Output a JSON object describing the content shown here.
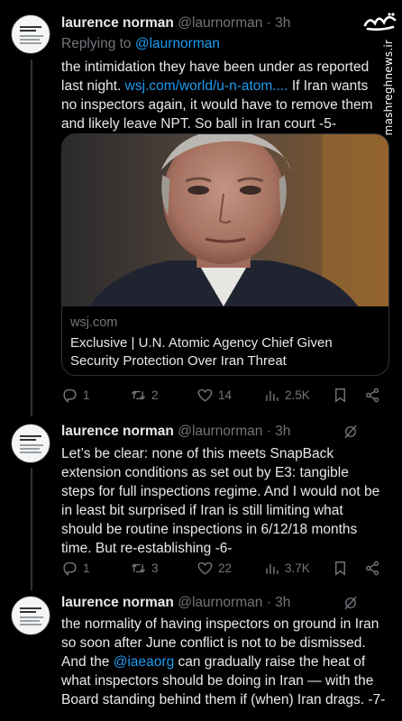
{
  "watermark": {
    "logo_text": "مشرق",
    "site": "mashreghnews.ir"
  },
  "tweets": [
    {
      "name": "laurence norman",
      "handle": "@laurnorman",
      "time": "· 3h",
      "reply_prefix": "Replying to ",
      "reply_handle": "@laurnorman",
      "text_before": "the intimidation they have been under as reported last night. ",
      "link": "wsj.com/world/u-n-atom....",
      "text_after": " If Iran wants no inspectors again, it would have to remove them and likely leave NPT. So ball in Iran court -5-",
      "card": {
        "domain": "wsj.com",
        "title": "Exclusive | U.N. Atomic Agency Chief Given Security Protection Over Iran Threat"
      },
      "actions": {
        "replies": "1",
        "reposts": "2",
        "likes": "14",
        "views": "2.5K"
      }
    },
    {
      "name": "laurence norman",
      "handle": "@laurnorman",
      "time": "· 3h",
      "text": "Let’s be clear: none of this meets SnapBack extension conditions as set out by E3: tangible steps for full inspections regime. And I would not be in least bit surprised if Iran is still limiting what should be routine inspections in 6/12/18 months time. But re-establishing -6-",
      "actions": {
        "replies": "1",
        "reposts": "3",
        "likes": "22",
        "views": "3.7K"
      }
    },
    {
      "name": "laurence norman",
      "handle": "@laurnorman",
      "time": "· 3h",
      "text_before": "the normality of having inspectors on ground in Iran so soon after June conflict is not to be dismissed. And the ",
      "mention": "@iaeaorg",
      "text_after": " can gradually raise the heat of what inspectors should be doing in Iran — with the Board standing behind them if (when) Iran drags. -7-"
    }
  ]
}
